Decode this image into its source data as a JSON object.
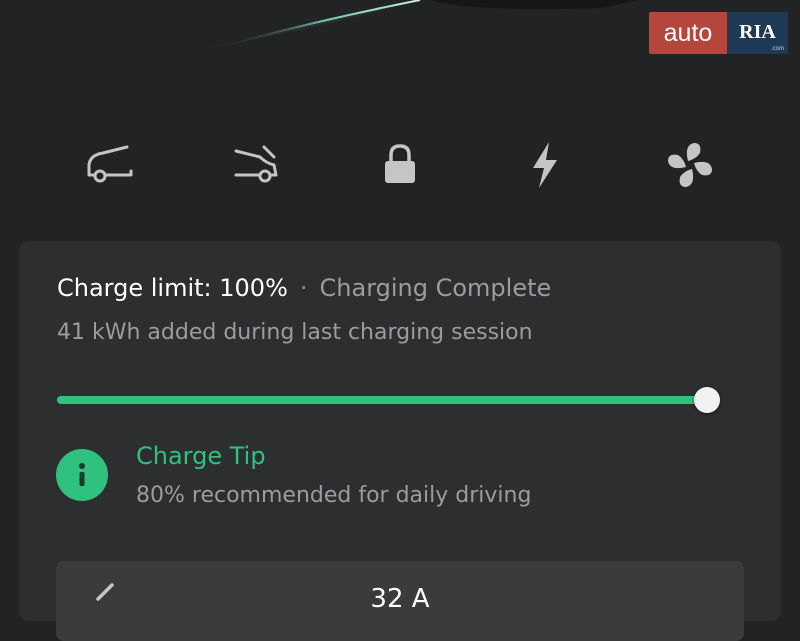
{
  "watermark": {
    "brand_left": "auto",
    "brand_right": "RIA",
    "brand_sub": ".com"
  },
  "controls": [
    {
      "icon": "frunk-open-icon"
    },
    {
      "icon": "trunk-open-icon"
    },
    {
      "icon": "lock-icon"
    },
    {
      "icon": "charge-bolt-icon"
    },
    {
      "icon": "fan-icon"
    }
  ],
  "charge": {
    "limit_label": "Charge limit: 100%",
    "separator": "·",
    "status": "Charging Complete",
    "session_text": "41 kWh added during last charging session",
    "limit_percent": 100
  },
  "tip": {
    "icon": "info-icon",
    "title": "Charge Tip",
    "text": "80% recommended for daily driving"
  },
  "current": {
    "value": "32 A"
  },
  "colors": {
    "background": "#222324",
    "card": "#2d2e2f",
    "accent": "#2ec27e",
    "text_primary": "#ffffff",
    "text_secondary": "#9a9c9f"
  }
}
